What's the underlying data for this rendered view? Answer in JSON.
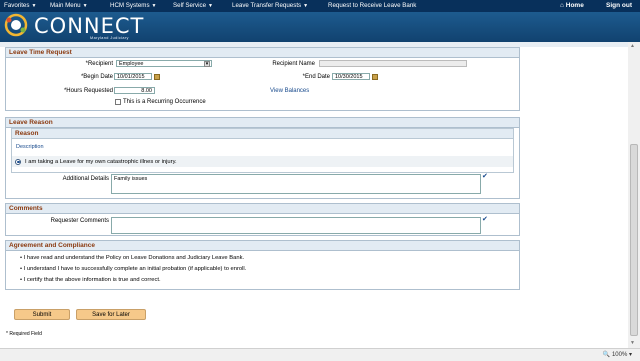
{
  "nav": {
    "items": [
      {
        "label": "Favorites",
        "caret": true
      },
      {
        "label": "Main Menu",
        "caret": true
      },
      {
        "label": "HCM Systems",
        "caret": true
      },
      {
        "label": "Self Service",
        "caret": true
      },
      {
        "label": "Leave Transfer Requests",
        "caret": true
      },
      {
        "label": "Request to Receive Leave Bank",
        "caret": false
      }
    ],
    "home": "Home",
    "signout": "Sign out"
  },
  "brand": {
    "name": "CONNECT",
    "subtitle": "Maryland Judiciary"
  },
  "leave_time": {
    "title": "Leave Time Request",
    "recipient_label": "*Recipient",
    "recipient_value": "Employee",
    "recipient_name_label": "Recipient Name",
    "recipient_name_value": "",
    "begin_label": "*Begin Date",
    "begin_value": "10/01/2015",
    "end_label": "*End Date",
    "end_value": "10/30/2015",
    "hours_label": "*Hours Requested",
    "hours_value": "8.00",
    "view_balances": "View Balances",
    "recurring_label": "This is a Recurring Occurrence"
  },
  "leave_reason": {
    "title": "Leave Reason",
    "sub_title": "Reason",
    "col_header": "Description",
    "option": "I am taking a Leave for my own catastrophic illnes or injury.",
    "details_label": "Additional Details",
    "details_value": "Family issues"
  },
  "comments": {
    "title": "Comments",
    "label": "Requester Comments",
    "value": ""
  },
  "agreement": {
    "title": "Agreement and Compliance",
    "bullets": [
      "I have read and understand the Policy on Leave Donations and Judiciary Leave Bank.",
      "I understand I have to successfully complete an initial probation (if applicable) to enroll.",
      "I certify that the above information is true and correct."
    ]
  },
  "actions": {
    "submit": "Submit",
    "save": "Save for Later"
  },
  "required_note": "* Required Field",
  "status": {
    "zoom": "100%"
  },
  "colors": {
    "nav": "#08305b",
    "banner": "#1d5b8f",
    "section_title": "#8b3a10",
    "button": "#f6c98a"
  }
}
